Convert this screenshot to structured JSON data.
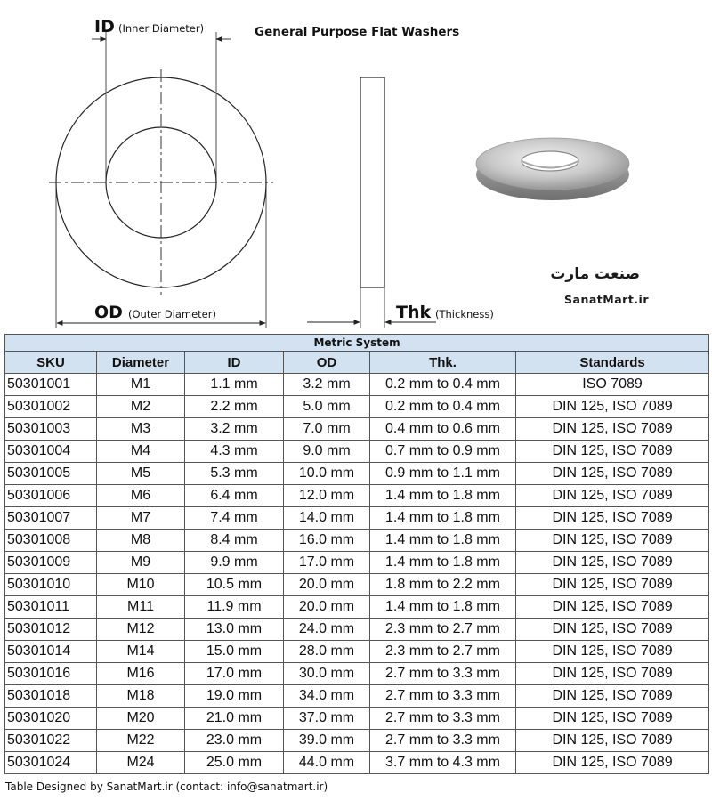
{
  "header": {
    "title": "General Purpose Flat Washers",
    "id_abbr": "ID",
    "id_full": "(Inner Diameter)",
    "od_abbr": "OD",
    "od_full": "(Outer Diameter)",
    "thk_abbr": "Thk",
    "thk_full": "(Thickness)"
  },
  "brand": {
    "name_fa": "صنعت مارت",
    "name_en": "SanatMart.ir"
  },
  "table": {
    "caption": "Metric System",
    "columns": [
      "SKU",
      "Diameter",
      "ID",
      "OD",
      "Thk.",
      "Standards"
    ],
    "rows": [
      [
        "50301001",
        "M1",
        "1.1 mm",
        "3.2 mm",
        "0.2 mm to 0.4 mm",
        "ISO 7089"
      ],
      [
        "50301002",
        "M2",
        "2.2 mm",
        "5.0 mm",
        "0.2 mm to 0.4 mm",
        "DIN 125, ISO 7089"
      ],
      [
        "50301003",
        "M3",
        "3.2 mm",
        "7.0 mm",
        "0.4 mm to 0.6 mm",
        "DIN 125, ISO 7089"
      ],
      [
        "50301004",
        "M4",
        "4.3 mm",
        "9.0 mm",
        "0.7 mm to 0.9 mm",
        "DIN 125, ISO 7089"
      ],
      [
        "50301005",
        "M5",
        "5.3 mm",
        "10.0 mm",
        "0.9 mm to 1.1 mm",
        "DIN 125, ISO 7089"
      ],
      [
        "50301006",
        "M6",
        "6.4 mm",
        "12.0 mm",
        "1.4 mm to 1.8 mm",
        "DIN 125, ISO 7089"
      ],
      [
        "50301007",
        "M7",
        "7.4 mm",
        "14.0 mm",
        "1.4 mm to 1.8 mm",
        "DIN 125, ISO 7089"
      ],
      [
        "50301008",
        "M8",
        "8.4 mm",
        "16.0 mm",
        "1.4 mm to 1.8 mm",
        "DIN 125, ISO 7089"
      ],
      [
        "50301009",
        "M9",
        "9.9 mm",
        "17.0 mm",
        "1.4 mm to 1.8 mm",
        "DIN 125, ISO 7089"
      ],
      [
        "50301010",
        "M10",
        "10.5 mm",
        "20.0 mm",
        "1.8 mm to 2.2 mm",
        "DIN 125, ISO 7089"
      ],
      [
        "50301011",
        "M11",
        "11.9 mm",
        "20.0 mm",
        "1.4 mm to 1.8 mm",
        "DIN 125, ISO 7089"
      ],
      [
        "50301012",
        "M12",
        "13.0 mm",
        "24.0 mm",
        "2.3 mm to 2.7 mm",
        "DIN 125, ISO 7089"
      ],
      [
        "50301014",
        "M14",
        "15.0 mm",
        "28.0 mm",
        "2.3 mm to 2.7 mm",
        "DIN 125, ISO 7089"
      ],
      [
        "50301016",
        "M16",
        "17.0 mm",
        "30.0 mm",
        "2.7 mm to 3.3 mm",
        "DIN 125, ISO 7089"
      ],
      [
        "50301018",
        "M18",
        "19.0 mm",
        "34.0 mm",
        "2.7 mm to 3.3 mm",
        "DIN 125, ISO 7089"
      ],
      [
        "50301020",
        "M20",
        "21.0 mm",
        "37.0 mm",
        "2.7 mm to 3.3 mm",
        "DIN 125, ISO 7089"
      ],
      [
        "50301022",
        "M22",
        "23.0 mm",
        "39.0 mm",
        "2.7 mm to 3.3 mm",
        "DIN 125, ISO 7089"
      ],
      [
        "50301024",
        "M24",
        "25.0 mm",
        "44.0 mm",
        "3.7 mm to 4.3 mm",
        "DIN 125, ISO 7089"
      ]
    ]
  },
  "footer": {
    "text": "Table Designed by SanatMart.ir (contact: info@sanatmart.ir)"
  }
}
